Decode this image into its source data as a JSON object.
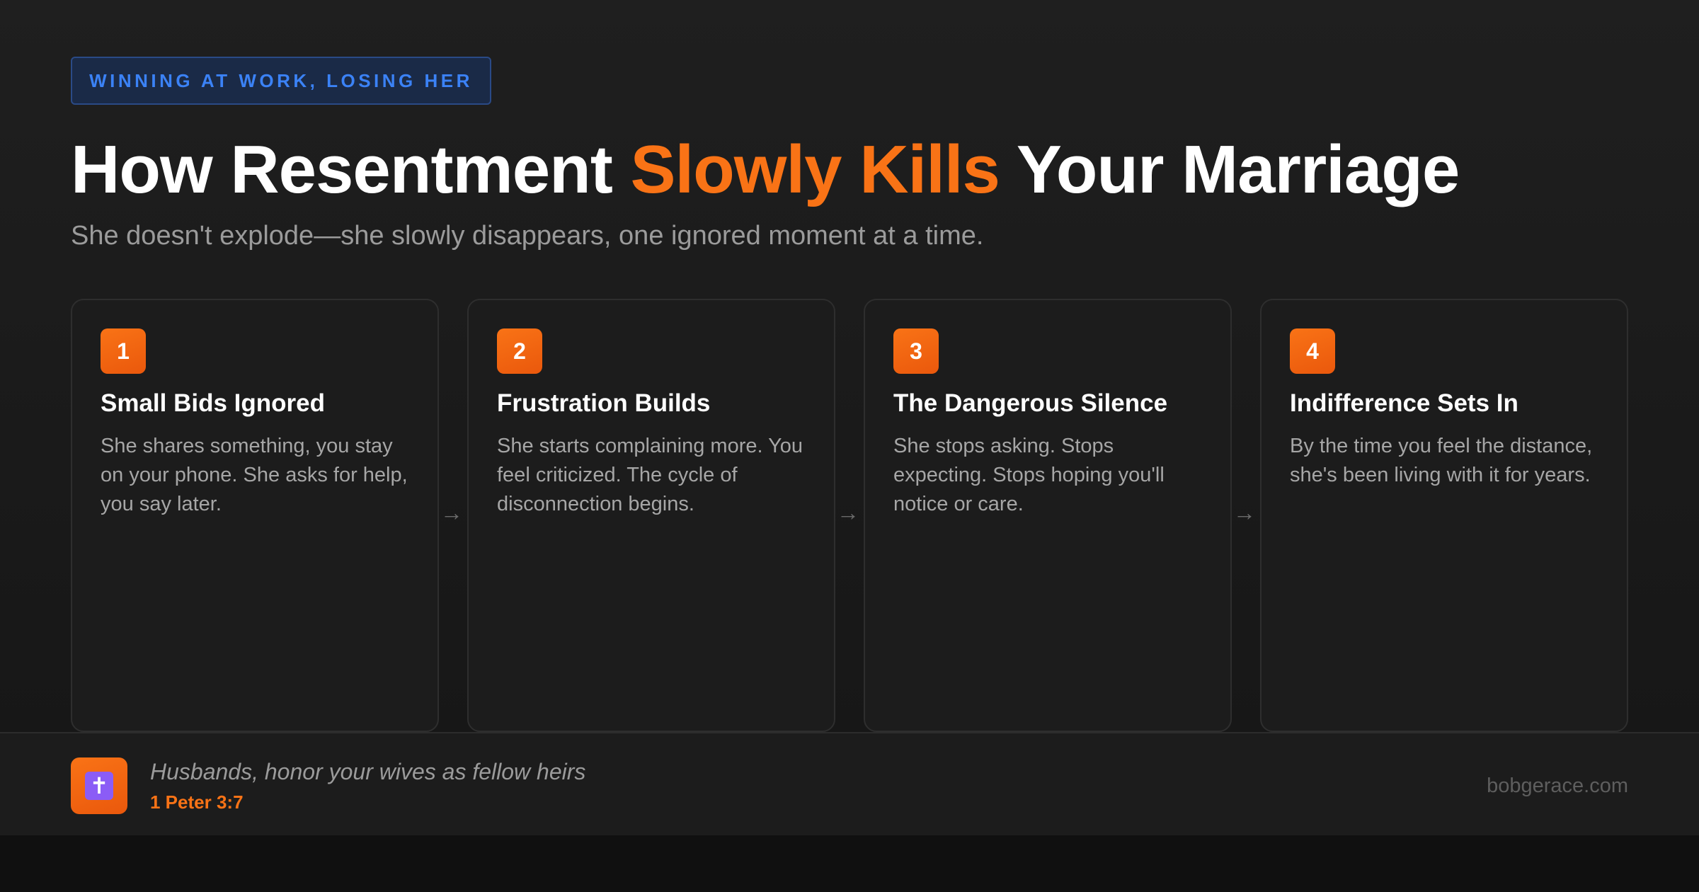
{
  "tag": "WINNING AT WORK, LOSING HER",
  "title": {
    "before": "How Resentment ",
    "highlight": "Slowly Kills",
    "after": " Your Marriage"
  },
  "subtitle": "She doesn't explode—she slowly disappears, one ignored moment at a time.",
  "steps": [
    {
      "number": "1",
      "title": "Small Bids Ignored",
      "text": "She shares something, you stay on your phone. She asks for help, you say later."
    },
    {
      "number": "2",
      "title": "Frustration Builds",
      "text": "She starts complaining more. You feel criticized. The cycle of disconnection begins."
    },
    {
      "number": "3",
      "title": "The Dangerous Silence",
      "text": "She stops asking. Stops expecting. Stops hoping you'll notice or care."
    },
    {
      "number": "4",
      "title": "Indifference Sets In",
      "text": "By the time you feel the distance, she's been living with it for years."
    }
  ],
  "arrow": "→",
  "footer": {
    "icon": "cross-icon",
    "icon_glyph": "✝",
    "quote": "Husbands, honor your wives as fellow heirs",
    "reference": "1 Peter 3:7",
    "site": "bobgerace.com"
  },
  "colors": {
    "accent": "#f97316",
    "tag_text": "#3b82f6",
    "tag_bg": "#1a2a47",
    "icon_glyph_bg": "#8b5cf6"
  }
}
